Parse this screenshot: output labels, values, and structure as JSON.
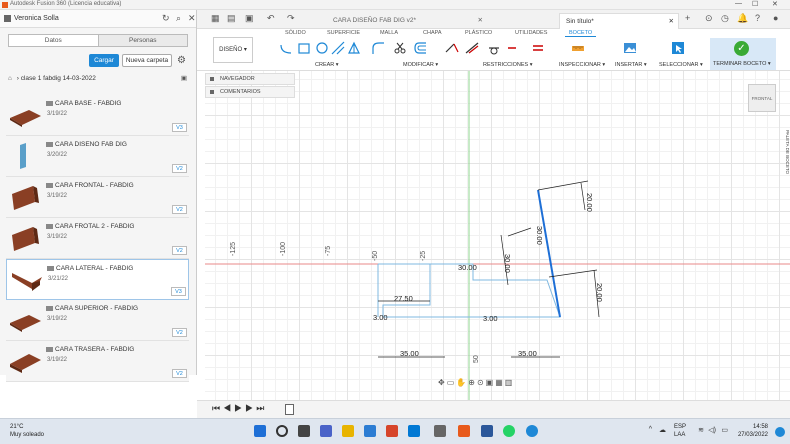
{
  "window": {
    "title": "Autodesk Fusion 360 (Licencia educativa)"
  },
  "data_panel": {
    "user": "Veronica Solla",
    "tabs": [
      "Datos",
      "Personas"
    ],
    "upload_label": "Cargar",
    "new_folder_label": "Nueva carpeta",
    "breadcrumb": "clase 1 fabdig 14-03-2022",
    "items": [
      {
        "name": "CARA BASE - FABDIG",
        "date": "3/19/22",
        "version": "V3"
      },
      {
        "name": "CARA DISENO FAB DIG",
        "date": "3/20/22",
        "version": "V2"
      },
      {
        "name": "CARA FRONTAL - FABDIG",
        "date": "3/19/22",
        "version": "V2"
      },
      {
        "name": "CARA FROTAL 2 - FABDIG",
        "date": "3/19/22",
        "version": "V2"
      },
      {
        "name": "CARA LATERAL - FABDIG",
        "date": "3/21/22",
        "version": "V3"
      },
      {
        "name": "CARA SUPERIOR - FABDIG",
        "date": "3/19/22",
        "version": "V2"
      },
      {
        "name": "CARA TRASERA - FABDIG",
        "date": "3/19/22",
        "version": "V2"
      }
    ]
  },
  "document_tabs": [
    {
      "label": "CARA DISEÑO FAB DIG v2*",
      "active": false
    },
    {
      "label": "Sin título*",
      "active": true
    }
  ],
  "toolbar": {
    "workspace": "DISEÑO",
    "tabs": [
      "SÓLIDO",
      "SUPERFICIE",
      "MALLA",
      "CHAPA",
      "PLÁSTICO",
      "UTILIDADES",
      "BOCETO"
    ],
    "active_tab": "BOCETO",
    "groups": [
      "CREAR",
      "MODIFICAR",
      "RESTRICCIONES",
      "INSPECCIONAR",
      "INSERTAR",
      "SELECCIONAR"
    ],
    "finish_label": "TERMINAR BOCETO"
  },
  "browser": {
    "navigator": "NAVEGADOR",
    "comments": "COMENTARIOS"
  },
  "viewcube": "FRONTAL",
  "sketch_palette": "PALETA DE BOCETO",
  "sketch": {
    "axis_labels": [
      "-125",
      "-100",
      "-75",
      "-50",
      "-25",
      "50"
    ],
    "dimensions": [
      "30.00",
      "27.50",
      "3.00",
      "3.00",
      "35.00",
      "35.00",
      "20.00",
      "20.00",
      "30.00",
      "30.00"
    ]
  },
  "taskbar": {
    "temperature": "21°C",
    "weather": "Muy soleado",
    "language": "ESP",
    "region": "LAA",
    "time": "14:58",
    "date": "27/03/2022"
  }
}
